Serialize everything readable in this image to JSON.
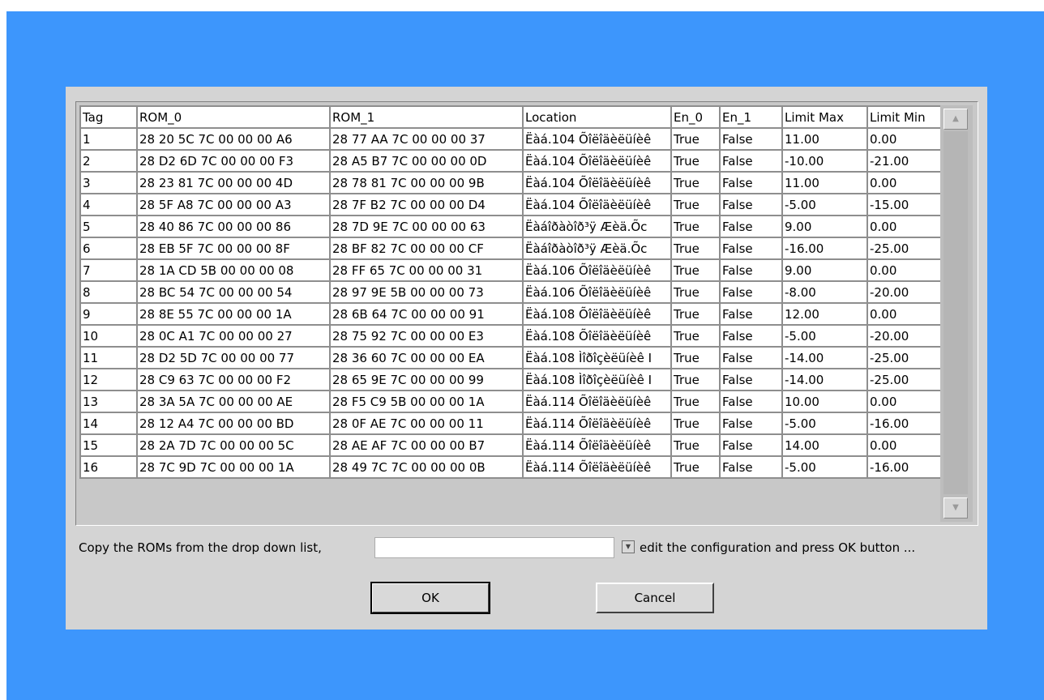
{
  "table": {
    "headers": [
      "Tag",
      "ROM_0",
      "ROM_1",
      "Location",
      "En_0",
      "En_1",
      "Limit Max",
      "Limit Min"
    ],
    "rows": [
      [
        "1",
        "28 20 5C 7C 00 00 00 A6",
        "28 77 AA 7C 00 00 00 37",
        "Ëàá.104 Õîëîäèëüíèê",
        "True",
        "False",
        "11.00",
        "0.00"
      ],
      [
        "2",
        "28 D2 6D 7C 00 00 00 F3",
        "28 A5 B7 7C 00 00 00 0D",
        "Ëàá.104 Õîëîäèëüíèê",
        "True",
        "False",
        "-10.00",
        "-21.00"
      ],
      [
        "3",
        "28 23 81 7C 00 00 00 4D",
        "28 78 81 7C 00 00 00 9B",
        "Ëàá.104 Õîëîäèëüíèê",
        "True",
        "False",
        "11.00",
        "0.00"
      ],
      [
        "4",
        "28 5F A8 7C 00 00 00 A3",
        "28 7F B2 7C 00 00 00 D4",
        "Ëàá.104 Õîëîäèëüíèê",
        "True",
        "False",
        "-5.00",
        "-15.00"
      ],
      [
        "5",
        "28 40 86 7C 00 00 00 86",
        "28 7D 9E 7C 00 00 00 63",
        "Ëàáîðàòîð³ÿ Æèä.Õc",
        "True",
        "False",
        "9.00",
        "0.00"
      ],
      [
        "6",
        "28 EB 5F 7C 00 00 00 8F",
        "28 BF 82 7C 00 00 00 CF",
        "Ëàáîðàòîð³ÿ Æèä.Õc",
        "True",
        "False",
        "-16.00",
        "-25.00"
      ],
      [
        "7",
        "28 1A CD 5B 00 00 00 08",
        "28 FF 65 7C 00 00 00 31",
        "Ëàá.106 Õîëîäèëüíèê",
        "True",
        "False",
        "9.00",
        "0.00"
      ],
      [
        "8",
        "28 BC 54 7C 00 00 00 54",
        "28 97 9E 5B 00 00 00 73",
        "Ëàá.106 Õîëîäèëüíèê",
        "True",
        "False",
        "-8.00",
        "-20.00"
      ],
      [
        "9",
        "28 8E 55 7C 00 00 00 1A",
        "28 6B 64 7C 00 00 00 91",
        "Ëàá.108 Õîëîäèëüíèê",
        "True",
        "False",
        "12.00",
        "0.00"
      ],
      [
        "10",
        "28 0C A1 7C 00 00 00 27",
        "28 75 92 7C 00 00 00 E3",
        "Ëàá.108 Õîëîäèëüíèê",
        "True",
        "False",
        "-5.00",
        "-20.00"
      ],
      [
        "11",
        "28 D2 5D 7C 00 00 00 77",
        "28 36 60 7C 00 00 00 EA",
        "Ëàá.108 Ìîðîçèëüíèê I",
        "True",
        "False",
        "-14.00",
        "-25.00"
      ],
      [
        "12",
        "28 C9 63 7C 00 00 00 F2",
        "28 65 9E 7C 00 00 00 99",
        "Ëàá.108 Ìîðîçèëüíèê I",
        "True",
        "False",
        "-14.00",
        "-25.00"
      ],
      [
        "13",
        "28 3A 5A 7C 00 00 00 AE",
        "28 F5 C9 5B 00 00 00 1A",
        "Ëàá.114 Õîëîäèëüíèê",
        "True",
        "False",
        "10.00",
        "0.00"
      ],
      [
        "14",
        "28 12 A4 7C 00 00 00 BD",
        "28 0F AE 7C 00 00 00 11",
        "Ëàá.114 Õîëîäèëüíèê",
        "True",
        "False",
        "-5.00",
        "-16.00"
      ],
      [
        "15",
        "28 2A 7D 7C 00 00 00 5C",
        "28 AE AF 7C 00 00 00 B7",
        "Ëàá.114 Õîëîäèëüíèê",
        "True",
        "False",
        "14.00",
        "0.00"
      ],
      [
        "16",
        "28 7C 9D 7C 00 00 00 1A",
        "28 49 7C 7C 00 00 00 0B",
        "Ëàá.114 Õîëîäèëüíèê",
        "True",
        "False",
        "-5.00",
        "-16.00"
      ]
    ]
  },
  "scrollbar": {
    "up_icon": "▲",
    "down_icon": "▼"
  },
  "copy_row": {
    "label_before": "Copy the ROMs from the drop down list,",
    "input_value": "",
    "dropdown_icon": "▼",
    "label_after": "edit the configuration and press OK button ..."
  },
  "buttons": {
    "ok_label": "OK",
    "cancel_label": "Cancel"
  },
  "colors": {
    "background": "#3d96fc",
    "panel": "#d4d4d4"
  }
}
